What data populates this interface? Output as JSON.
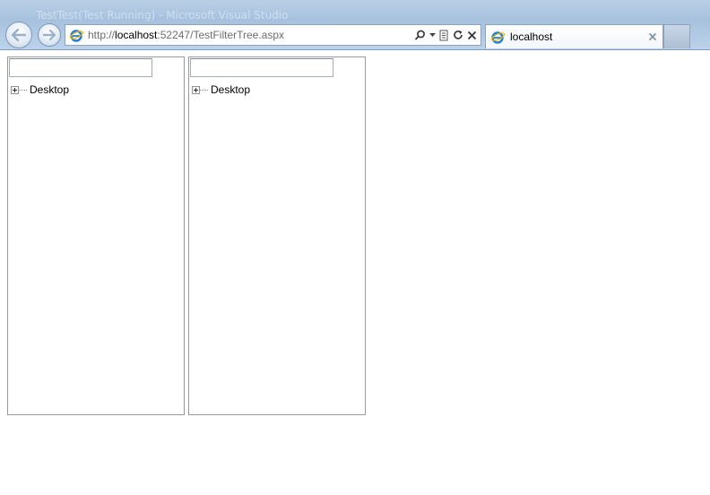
{
  "window": {
    "title": "TestTest(Test Running) - Microsoft Visual Studio"
  },
  "toolbar": {
    "back_icon": "back-arrow-icon",
    "forward_icon": "forward-arrow-icon"
  },
  "address": {
    "scheme": "http://",
    "host": "localhost",
    "rest": ":52247/TestFilterTree.aspx",
    "tools": [
      "search-icon",
      "dropdown-icon",
      "compat-view-icon",
      "refresh-icon",
      "stop-icon"
    ]
  },
  "tab": {
    "label": "localhost",
    "close_icon": "close-icon"
  },
  "panels": [
    {
      "filter_value": "",
      "tree": [
        {
          "label": "Desktop",
          "expanded": false
        }
      ]
    },
    {
      "filter_value": "",
      "tree": [
        {
          "label": "Desktop",
          "expanded": false
        }
      ]
    }
  ],
  "colors": {
    "chrome_bg": "#a7c1de",
    "panel_border": "#9a9a9a",
    "url_gray": "#6d6d6d"
  }
}
